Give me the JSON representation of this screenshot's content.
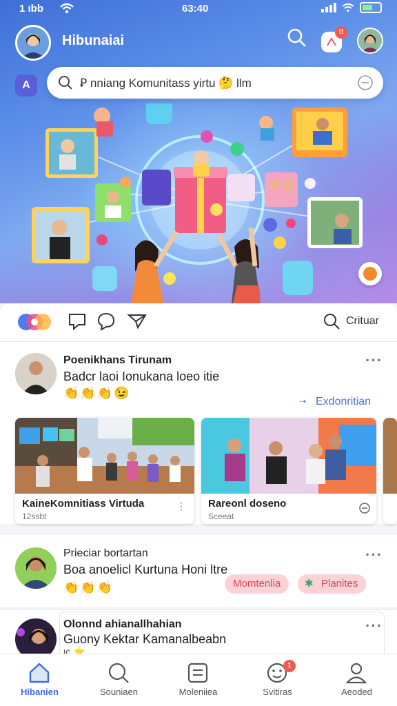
{
  "status_bar": {
    "left": "1 ιbb",
    "time": "63:40"
  },
  "header": {
    "title": "Hibunaiai",
    "notif_badge": "!!",
    "icons": [
      "search-icon",
      "notification-icon",
      "profile-avatar"
    ]
  },
  "side_badge": "A",
  "search": {
    "placeholder": "Ꝑ nniang Komunitass yirtu 🤔 llm"
  },
  "action_bar": {
    "search_label": "Crituar"
  },
  "posts": [
    {
      "name": "Poenikhans Tirunam",
      "text": "Badcr laoi Ionukana loeo itie",
      "reactions": "👏👏👏😉",
      "link": "Exdonritian",
      "media": [
        {
          "caption": "KaineKomnitiass Virtuda",
          "sub": "12ssbt"
        },
        {
          "caption": "Rareonl doseno",
          "sub": "Sceeat"
        }
      ]
    },
    {
      "name": "Prieciar bortartan",
      "text": "Boa anoelicl Kurtuna Honi ltre",
      "reactions": "👏👏👏",
      "tags": [
        "Momtenlia",
        "Planites"
      ]
    },
    {
      "name": "Olonnd ahianallhahian",
      "text": "Guony Kektar Kamanalbeabn",
      "sub": "ιc ⭐"
    }
  ],
  "tabs": [
    {
      "label": "Hibanien",
      "active": true
    },
    {
      "label": "Souniaen",
      "active": false
    },
    {
      "label": "Moleniiea",
      "active": false
    },
    {
      "label": "Svitiras",
      "active": false,
      "badge": "1"
    },
    {
      "label": "Aeoded",
      "active": false
    }
  ],
  "colors": {
    "accent": "#3d6be0",
    "hero_top": "#3f6fd8",
    "hero_bottom": "#b58be8",
    "alert": "#ef5a4e"
  }
}
